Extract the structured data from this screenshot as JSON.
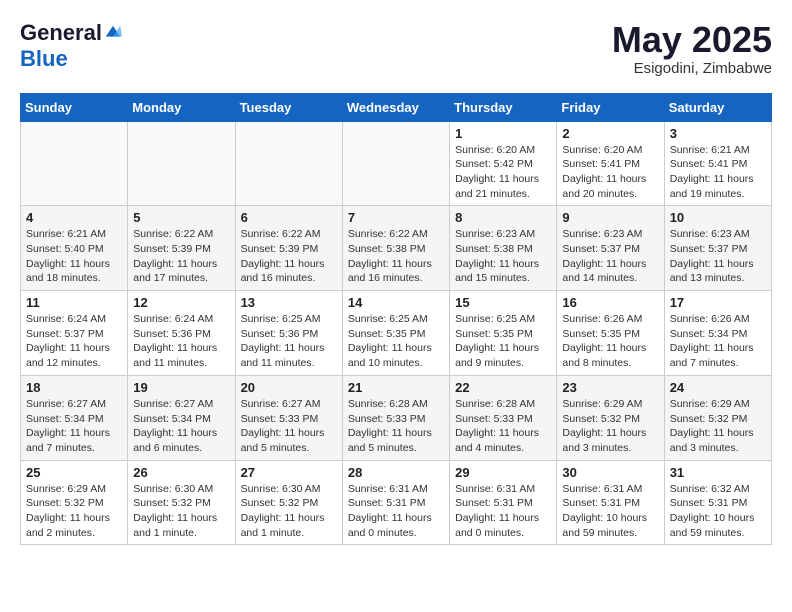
{
  "header": {
    "logo_general": "General",
    "logo_blue": "Blue",
    "month_year": "May 2025",
    "location": "Esigodini, Zimbabwe"
  },
  "days_of_week": [
    "Sunday",
    "Monday",
    "Tuesday",
    "Wednesday",
    "Thursday",
    "Friday",
    "Saturday"
  ],
  "weeks": [
    [
      {
        "day": "",
        "info": ""
      },
      {
        "day": "",
        "info": ""
      },
      {
        "day": "",
        "info": ""
      },
      {
        "day": "",
        "info": ""
      },
      {
        "day": "1",
        "info": "Sunrise: 6:20 AM\nSunset: 5:42 PM\nDaylight: 11 hours\nand 21 minutes."
      },
      {
        "day": "2",
        "info": "Sunrise: 6:20 AM\nSunset: 5:41 PM\nDaylight: 11 hours\nand 20 minutes."
      },
      {
        "day": "3",
        "info": "Sunrise: 6:21 AM\nSunset: 5:41 PM\nDaylight: 11 hours\nand 19 minutes."
      }
    ],
    [
      {
        "day": "4",
        "info": "Sunrise: 6:21 AM\nSunset: 5:40 PM\nDaylight: 11 hours\nand 18 minutes."
      },
      {
        "day": "5",
        "info": "Sunrise: 6:22 AM\nSunset: 5:39 PM\nDaylight: 11 hours\nand 17 minutes."
      },
      {
        "day": "6",
        "info": "Sunrise: 6:22 AM\nSunset: 5:39 PM\nDaylight: 11 hours\nand 16 minutes."
      },
      {
        "day": "7",
        "info": "Sunrise: 6:22 AM\nSunset: 5:38 PM\nDaylight: 11 hours\nand 16 minutes."
      },
      {
        "day": "8",
        "info": "Sunrise: 6:23 AM\nSunset: 5:38 PM\nDaylight: 11 hours\nand 15 minutes."
      },
      {
        "day": "9",
        "info": "Sunrise: 6:23 AM\nSunset: 5:37 PM\nDaylight: 11 hours\nand 14 minutes."
      },
      {
        "day": "10",
        "info": "Sunrise: 6:23 AM\nSunset: 5:37 PM\nDaylight: 11 hours\nand 13 minutes."
      }
    ],
    [
      {
        "day": "11",
        "info": "Sunrise: 6:24 AM\nSunset: 5:37 PM\nDaylight: 11 hours\nand 12 minutes."
      },
      {
        "day": "12",
        "info": "Sunrise: 6:24 AM\nSunset: 5:36 PM\nDaylight: 11 hours\nand 11 minutes."
      },
      {
        "day": "13",
        "info": "Sunrise: 6:25 AM\nSunset: 5:36 PM\nDaylight: 11 hours\nand 11 minutes."
      },
      {
        "day": "14",
        "info": "Sunrise: 6:25 AM\nSunset: 5:35 PM\nDaylight: 11 hours\nand 10 minutes."
      },
      {
        "day": "15",
        "info": "Sunrise: 6:25 AM\nSunset: 5:35 PM\nDaylight: 11 hours\nand 9 minutes."
      },
      {
        "day": "16",
        "info": "Sunrise: 6:26 AM\nSunset: 5:35 PM\nDaylight: 11 hours\nand 8 minutes."
      },
      {
        "day": "17",
        "info": "Sunrise: 6:26 AM\nSunset: 5:34 PM\nDaylight: 11 hours\nand 7 minutes."
      }
    ],
    [
      {
        "day": "18",
        "info": "Sunrise: 6:27 AM\nSunset: 5:34 PM\nDaylight: 11 hours\nand 7 minutes."
      },
      {
        "day": "19",
        "info": "Sunrise: 6:27 AM\nSunset: 5:34 PM\nDaylight: 11 hours\nand 6 minutes."
      },
      {
        "day": "20",
        "info": "Sunrise: 6:27 AM\nSunset: 5:33 PM\nDaylight: 11 hours\nand 5 minutes."
      },
      {
        "day": "21",
        "info": "Sunrise: 6:28 AM\nSunset: 5:33 PM\nDaylight: 11 hours\nand 5 minutes."
      },
      {
        "day": "22",
        "info": "Sunrise: 6:28 AM\nSunset: 5:33 PM\nDaylight: 11 hours\nand 4 minutes."
      },
      {
        "day": "23",
        "info": "Sunrise: 6:29 AM\nSunset: 5:32 PM\nDaylight: 11 hours\nand 3 minutes."
      },
      {
        "day": "24",
        "info": "Sunrise: 6:29 AM\nSunset: 5:32 PM\nDaylight: 11 hours\nand 3 minutes."
      }
    ],
    [
      {
        "day": "25",
        "info": "Sunrise: 6:29 AM\nSunset: 5:32 PM\nDaylight: 11 hours\nand 2 minutes."
      },
      {
        "day": "26",
        "info": "Sunrise: 6:30 AM\nSunset: 5:32 PM\nDaylight: 11 hours\nand 1 minute."
      },
      {
        "day": "27",
        "info": "Sunrise: 6:30 AM\nSunset: 5:32 PM\nDaylight: 11 hours\nand 1 minute."
      },
      {
        "day": "28",
        "info": "Sunrise: 6:31 AM\nSunset: 5:31 PM\nDaylight: 11 hours\nand 0 minutes."
      },
      {
        "day": "29",
        "info": "Sunrise: 6:31 AM\nSunset: 5:31 PM\nDaylight: 11 hours\nand 0 minutes."
      },
      {
        "day": "30",
        "info": "Sunrise: 6:31 AM\nSunset: 5:31 PM\nDaylight: 10 hours\nand 59 minutes."
      },
      {
        "day": "31",
        "info": "Sunrise: 6:32 AM\nSunset: 5:31 PM\nDaylight: 10 hours\nand 59 minutes."
      }
    ]
  ]
}
